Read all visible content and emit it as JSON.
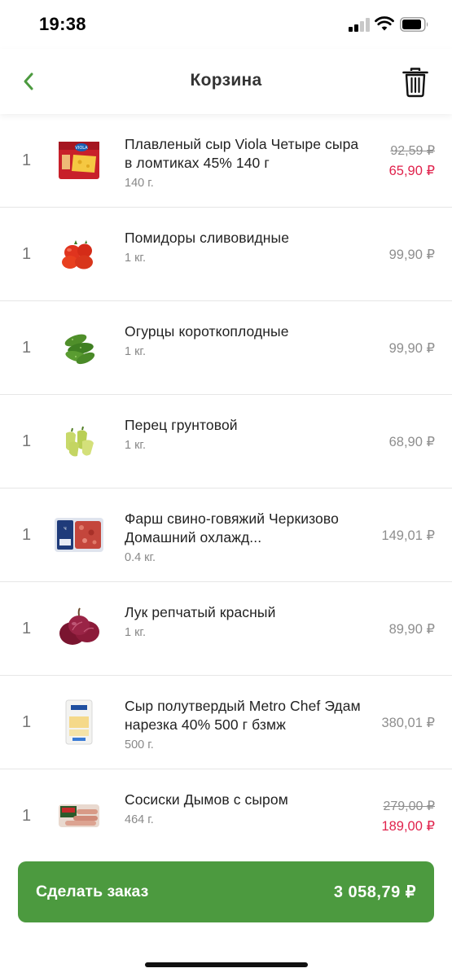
{
  "status_bar": {
    "time": "19:38"
  },
  "header": {
    "title": "Корзина"
  },
  "cart": {
    "items": [
      {
        "qty": "1",
        "name": "Плавленый сыр Viola Четыре сыра в ломтиках 45% 140 г",
        "weight": "140 г.",
        "old_price": "92,59 ₽",
        "price": "65,90 ₽",
        "image": "cheese-slices-package"
      },
      {
        "qty": "1",
        "name": "Помидоры сливовидные",
        "weight": "1 кг.",
        "price": "99,90 ₽",
        "image": "plum-tomatoes"
      },
      {
        "qty": "1",
        "name": "Огурцы короткоплодные",
        "weight": "1 кг.",
        "price": "99,90 ₽",
        "image": "cucumbers"
      },
      {
        "qty": "1",
        "name": "Перец грунтовой",
        "weight": "1 кг.",
        "price": "68,90 ₽",
        "image": "peppers"
      },
      {
        "qty": "1",
        "name": "Фарш свино-говяжий Черкизово Домашний охлажд...",
        "weight": "0.4 кг.",
        "price": "149,01 ₽",
        "image": "minced-meat-tray"
      },
      {
        "qty": "1",
        "name": "Лук репчатый красный",
        "weight": "1 кг.",
        "price": "89,90 ₽",
        "image": "red-onions"
      },
      {
        "qty": "1",
        "name": "Сыр полутвердый Metro Chef Эдам нарезка 40% 500 г бзмж",
        "weight": "500 г.",
        "price": "380,01 ₽",
        "image": "edam-cheese-package"
      },
      {
        "qty": "1",
        "name": "Сосиски Дымов с сыром",
        "weight": "464 г.",
        "old_price": "279,00 ₽",
        "price": "189,00 ₽",
        "image": "sausages-package"
      }
    ]
  },
  "order": {
    "label": "Сделать заказ",
    "total": "3 058,79 ₽"
  },
  "colors": {
    "accent": "#4c9a3f",
    "sale": "#e0224c",
    "muted": "#8e8e8e"
  }
}
